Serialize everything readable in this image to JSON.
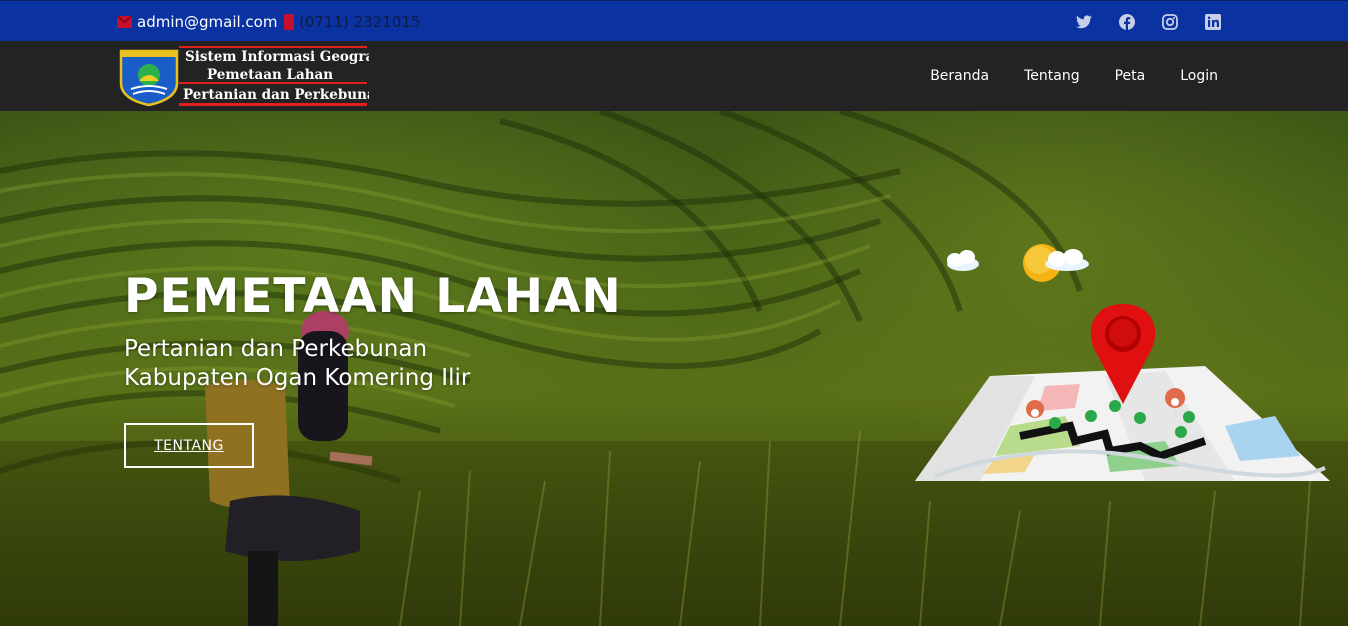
{
  "topbar": {
    "email": "admin@gmail.com",
    "phone": "(0711) 2321015",
    "socials": [
      "twitter-icon",
      "facebook-icon",
      "instagram-icon",
      "linkedin-icon"
    ]
  },
  "logo": {
    "line1": "Sistem Informasi Geografis",
    "line2": "Pemetaan Lahan",
    "line3": "Pertanian dan Perkebunan"
  },
  "nav": {
    "items": [
      "Beranda",
      "Tentang",
      "Peta",
      "Login"
    ]
  },
  "hero": {
    "title": "PEMETAAN LAHAN",
    "subtitle_line1": "Pertanian dan Perkebunan",
    "subtitle_line2": "Kabupaten Ogan Komering Ilir",
    "button": "TENTANG"
  },
  "colors": {
    "topbar": "#0a32a0",
    "navbar": "#232323",
    "accent_red": "#e0201c"
  }
}
